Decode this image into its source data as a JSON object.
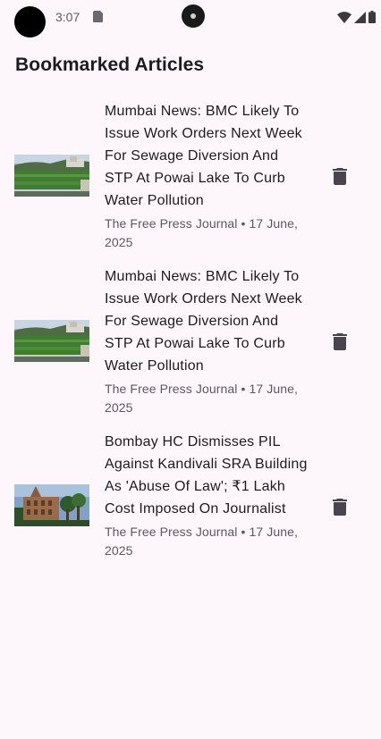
{
  "status_bar": {
    "time": "3:07",
    "icons": [
      "sim-card-icon",
      "wifi-icon",
      "cell-signal-icon",
      "battery-icon"
    ]
  },
  "header": {
    "title": "Bookmarked Articles"
  },
  "articles": [
    {
      "headline": "Mumbai News: BMC Likely To Issue Work Orders Next Week For Sewage Diversion And STP At Powai Lake To Curb Water Pollution",
      "meta": "The Free Press Journal • 17 June, 2025",
      "thumbnail": "lake-landscape-image",
      "action_icon": "delete-icon"
    },
    {
      "headline": "Mumbai News: BMC Likely To Issue Work Orders Next Week For Sewage Diversion And STP At Powai Lake To Curb Water Pollution",
      "meta": "The Free Press Journal • 17 June, 2025",
      "thumbnail": "lake-landscape-image",
      "action_icon": "delete-icon"
    },
    {
      "headline": "Bombay HC Dismisses PIL Against Kandivali SRA Building As 'Abuse Of Law'; ₹1 Lakh Cost Imposed On Journalist",
      "meta": "The Free Press Journal • 17 June, 2025",
      "thumbnail": "high-court-building-image",
      "action_icon": "delete-icon"
    }
  ],
  "colors": {
    "background": "#fdf7fc",
    "text_primary": "#1d1b20",
    "text_secondary": "#5b5860",
    "icon": "#49454f"
  }
}
